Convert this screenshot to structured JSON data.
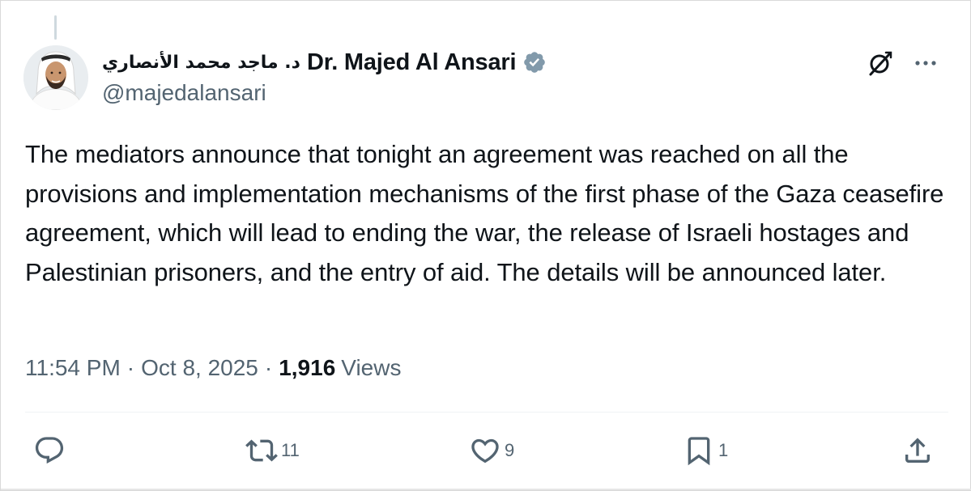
{
  "post": {
    "author": {
      "arabic_name": "د. ماجد محمد الأنصاري",
      "display_name": "Dr. Majed Al Ansari",
      "handle": "@majedalansari",
      "verified_icon": "verified-badge-icon",
      "avatar": "avatar-photo"
    },
    "text": "The mediators announce that tonight an agreement was reached on all the provisions and implementation mechanisms of the first phase of the Gaza ceasefire agreement, which will lead to ending the war, the release of Israeli hostages and Palestinian prisoners, and the entry of aid. The details will be announced later.",
    "time": "11:54 PM",
    "separator": "·",
    "date": "Oct 8, 2025",
    "views_count": "1,916",
    "views_label": "Views"
  },
  "header_icons": {
    "grok": "grok-icon",
    "more": "more-icon"
  },
  "actions": {
    "reply_count": "",
    "repost_count": "11",
    "like_count": "9",
    "bookmark_count": "1"
  },
  "colors": {
    "text": "#0f1419",
    "secondary": "#536471",
    "verified": "#829aab"
  }
}
